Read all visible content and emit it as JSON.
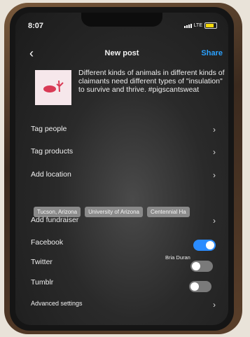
{
  "status": {
    "time": "8:07",
    "network": "LTE"
  },
  "header": {
    "back_icon": "chevron-left-icon",
    "title": "New post",
    "share": "Share"
  },
  "post": {
    "caption": "Different kinds of animals in different kinds of claimants need different types of \"insulation\" to survive and thrive. #pigscantsweat"
  },
  "options": {
    "tag_people": "Tag people",
    "tag_products": "Tag products",
    "add_location": "Add location",
    "add_fundraiser": "Add fundraiser",
    "advanced": "Advanced settings"
  },
  "locations": [
    "Tucson, Arizona",
    "University of Arizona",
    "Centennial Ha"
  ],
  "share_to": {
    "facebook": {
      "label": "Facebook",
      "account": "Bria Duran",
      "enabled": true
    },
    "twitter": {
      "label": "Twitter",
      "enabled": false
    },
    "tumblr": {
      "label": "Tumblr",
      "enabled": false
    }
  },
  "colors": {
    "accent": "#2aa1ff",
    "toggle_on": "#2a8cff"
  }
}
